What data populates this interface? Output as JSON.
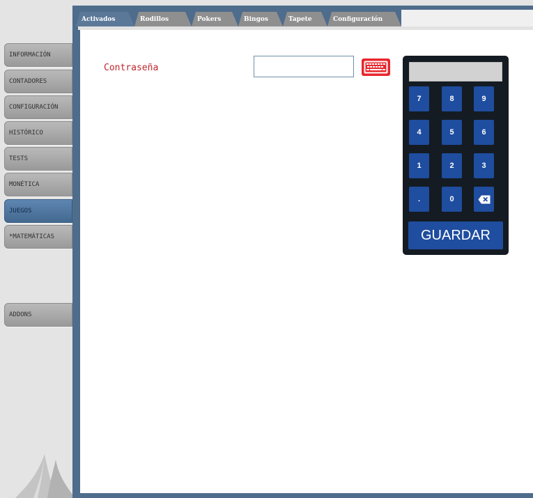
{
  "sidebar": {
    "items": [
      {
        "label": "INFORMACIÓN",
        "active": false
      },
      {
        "label": "CONTADORES",
        "active": false
      },
      {
        "label": "CONFIGURACIÓN",
        "active": false
      },
      {
        "label": "HISTÓRICO",
        "active": false
      },
      {
        "label": "TESTS",
        "active": false
      },
      {
        "label": "MONÉTICA",
        "active": false
      },
      {
        "label": "JUEGOS",
        "active": true
      },
      {
        "label": "*MATEMÁTICAS",
        "active": false
      },
      {
        "label": "ADDONS",
        "active": false
      }
    ]
  },
  "tabs": [
    {
      "label": "Activados",
      "active": true
    },
    {
      "label": "Rodillos",
      "active": false
    },
    {
      "label": "Pokers",
      "active": false
    },
    {
      "label": "Bingos",
      "active": false
    },
    {
      "label": "Tapete",
      "active": false
    },
    {
      "label": "Configuración",
      "active": false
    }
  ],
  "form": {
    "password_label": "Contraseña",
    "password_value": "",
    "keyboard_icon": "keyboard-icon"
  },
  "keypad": {
    "display": "",
    "keys": [
      "7",
      "8",
      "9",
      "4",
      "5",
      "6",
      "1",
      "2",
      "3",
      ".",
      "0",
      "⌫"
    ],
    "backspace_icon": "backspace-icon",
    "save_label": "GUARDAR"
  },
  "colors": {
    "frame": "#4e6c8c",
    "sidebar_active": "#4d769f",
    "keypad_bg": "#141b22",
    "key_blue": "#1f4d9f",
    "label_red": "#c0262e",
    "keyboard_red": "#e8262c"
  }
}
